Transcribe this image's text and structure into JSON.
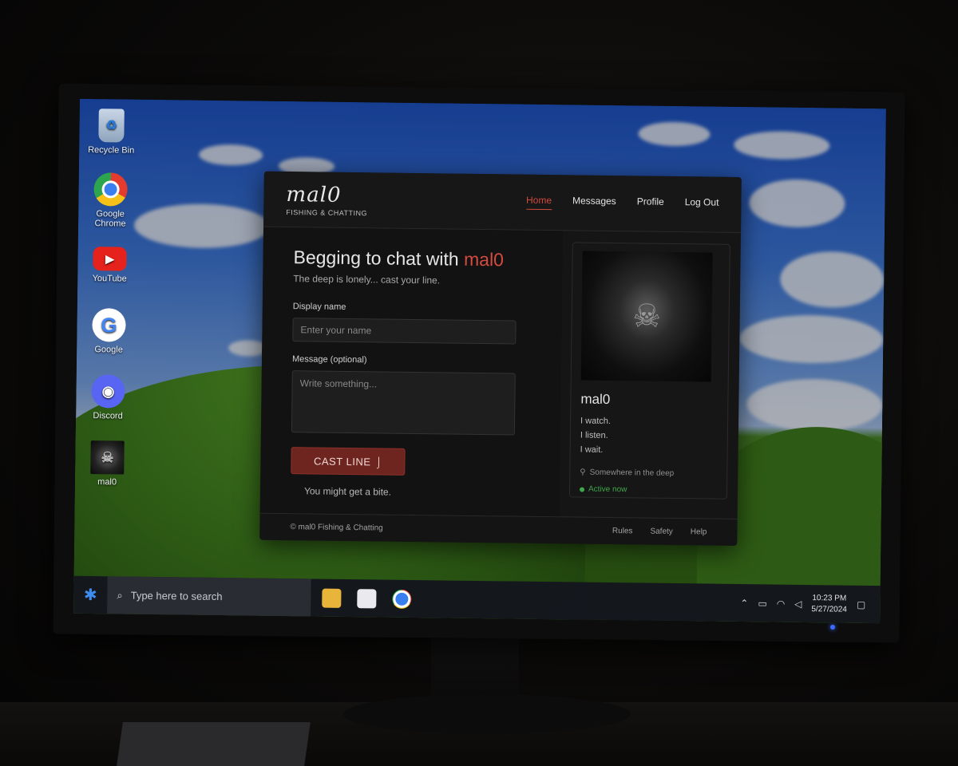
{
  "desktop": {
    "icons": [
      {
        "label": "Recycle Bin",
        "glyph": "♻"
      },
      {
        "label": "Google\nChrome",
        "glyph": ""
      },
      {
        "label": "YouTube",
        "glyph": "▶"
      },
      {
        "label": "Google",
        "glyph": "G"
      },
      {
        "label": "Discord",
        "glyph": "◉"
      },
      {
        "label": "mal0",
        "glyph": "☠"
      }
    ]
  },
  "app": {
    "brand": "mal0",
    "tagline": "FISHING & CHATTING",
    "nav": [
      {
        "label": "Home",
        "active": true
      },
      {
        "label": "Messages",
        "active": false
      },
      {
        "label": "Profile",
        "active": false
      },
      {
        "label": "Log Out",
        "active": false
      }
    ],
    "heading_prefix": "Begging to chat with ",
    "heading_accent": "mal0",
    "subtitle": "The deep is lonely... cast your line.",
    "display_name_label": "Display name",
    "display_name_placeholder": "Enter your name",
    "message_label": "Message (optional)",
    "message_placeholder": "Write something...",
    "cast_button": "CAST LINE",
    "hint": "You might get a bite.",
    "profile": {
      "name": "mal0",
      "bio": [
        "I watch.",
        "I listen.",
        "I wait."
      ],
      "location": "Somewhere in the deep",
      "status": "Active now"
    },
    "footer": {
      "copyright": "© mal0 Fishing & Chatting",
      "links": [
        "Rules",
        "Safety",
        "Help"
      ]
    }
  },
  "taskbar": {
    "search_placeholder": "Type here to search",
    "time": "10:23 PM",
    "date": "5/27/2024"
  },
  "colors": {
    "accent": "#d44b3f",
    "cast_button_bg": "#6e2520",
    "status_green": "#3fa84a"
  }
}
